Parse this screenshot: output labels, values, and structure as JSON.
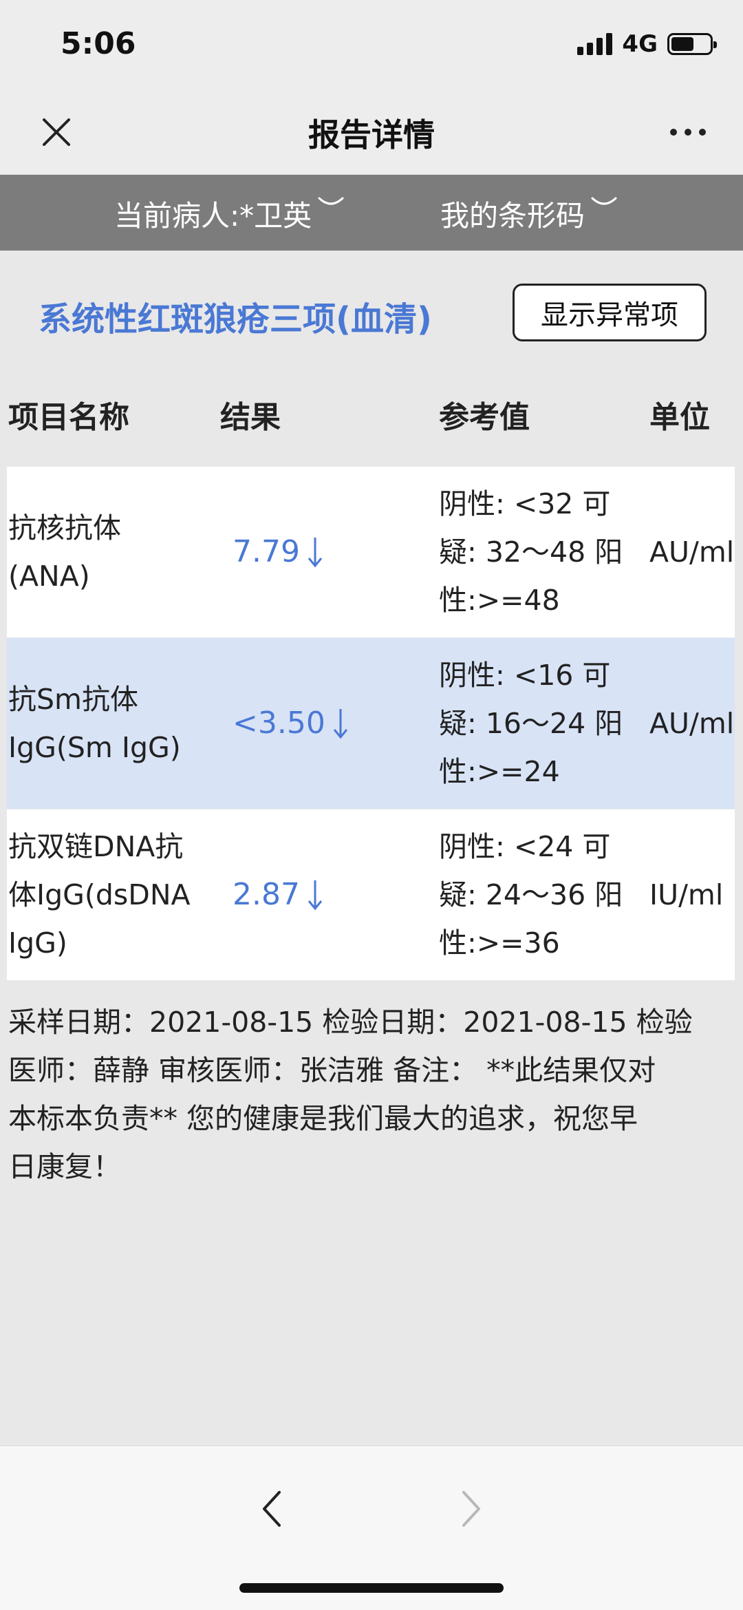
{
  "status": {
    "time": "5:06",
    "network": "4G",
    "battery_level": 0.6
  },
  "nav": {
    "title": "报告详情",
    "close_icon": "close-icon",
    "more_icon": "more-icon"
  },
  "patient_bar": {
    "patient": "当前病人:*卫英",
    "barcode": "我的条形码"
  },
  "report": {
    "title": "系统性红斑狼疮三项(血清)",
    "abnormal_button": "显示异常项",
    "headers": {
      "name": "项目名称",
      "result": "结果",
      "ref": "参考值",
      "unit": "单位"
    },
    "rows": [
      {
        "name_lines": [
          "抗核抗体",
          "(ANA)"
        ],
        "result": "7.79",
        "flag": "low",
        "ref_lines": [
          "阴性: <32 可",
          "疑: 32～48 阳",
          "性:>=48"
        ],
        "unit": "AU/ml"
      },
      {
        "name_lines": [
          "抗Sm抗体",
          "IgG(Sm IgG)"
        ],
        "result": "<3.50",
        "flag": "low",
        "ref_lines": [
          "阴性: <16 可",
          "疑: 16～24 阳",
          "性:>=24"
        ],
        "unit": "AU/ml"
      },
      {
        "name_lines": [
          "抗双链DNA抗",
          "体IgG(dsDNA",
          "IgG)"
        ],
        "result": "2.87",
        "flag": "low",
        "ref_lines": [
          "阴性: <24 可",
          "疑: 24～36 阳",
          "性:>=36"
        ],
        "unit": "IU/ml"
      }
    ],
    "note_lines": [
      "采样日期：2021-08-15 检验日期：2021-08-15 检验",
      "医师：薛静 审核医师：张洁雅 备注： **此结果仅对",
      "本标本负责** 您的健康是我们最大的追求，祝您早",
      "日康复！"
    ]
  },
  "colors": {
    "accent": "#4a78d4",
    "highlight_row": "#d8e3f6",
    "patient_bar": "#7c7c7c"
  }
}
